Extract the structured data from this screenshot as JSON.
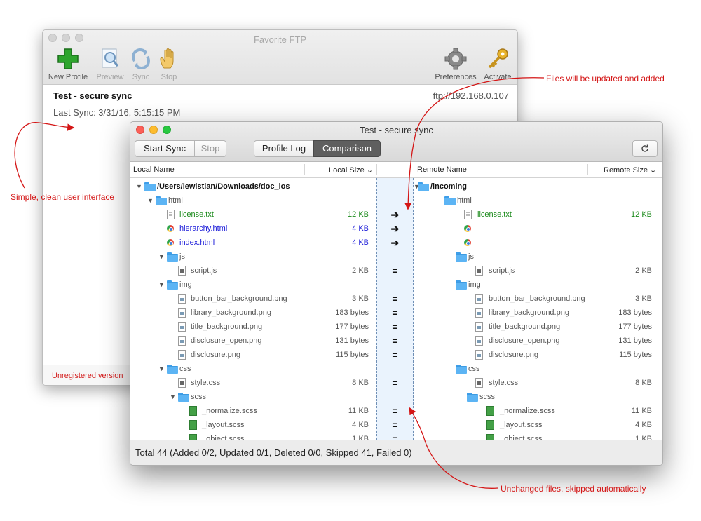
{
  "main_window": {
    "title": "Favorite FTP",
    "toolbar": [
      {
        "label": "New Profile",
        "icon": "plus-icon",
        "enabled": true
      },
      {
        "label": "Preview",
        "icon": "magnifier-icon",
        "enabled": false
      },
      {
        "label": "Sync",
        "icon": "sync-icon",
        "enabled": false
      },
      {
        "label": "Stop",
        "icon": "hand-icon",
        "enabled": false
      },
      {
        "label": "Preferences",
        "icon": "gear-icon",
        "enabled": true
      },
      {
        "label": "Activate",
        "icon": "key-icon",
        "enabled": true
      }
    ],
    "profile_name": "Test - secure sync",
    "profile_url": "ftp://192.168.0.107",
    "last_sync": "Last Sync: 3/31/16, 5:15:15 PM",
    "footer": "Unregistered version"
  },
  "sync_window": {
    "title": "Test - secure sync",
    "buttons": {
      "start": "Start Sync",
      "stop": "Stop",
      "profile_log": "Profile Log",
      "comparison": "Comparison"
    },
    "columns": {
      "local_name": "Local Name",
      "local_size": "Local Size",
      "remote_name": "Remote Name",
      "remote_size": "Remote Size"
    },
    "rows": [
      {
        "depth": 0,
        "type": "folder",
        "twisty": "▼",
        "local": "/Users/lewistian/Downloads/doc_ios",
        "local_size": "",
        "op": "",
        "remote": "/incoming",
        "remote_size": "",
        "bold": true
      },
      {
        "depth": 1,
        "type": "folder",
        "twisty": "▼",
        "local": "html",
        "local_size": "",
        "op": "",
        "remote": "html",
        "remote_size": ""
      },
      {
        "depth": 2,
        "type": "txt",
        "local": "license.txt",
        "local_size": "12 KB",
        "op": "➔",
        "remote": "license.txt",
        "remote_size": "12 KB",
        "color": "green"
      },
      {
        "depth": 2,
        "type": "html",
        "local": "hierarchy.html",
        "local_size": "4 KB",
        "op": "➔",
        "remote": "",
        "remote_size": "",
        "color": "blue"
      },
      {
        "depth": 2,
        "type": "html",
        "local": "index.html",
        "local_size": "4 KB",
        "op": "➔",
        "remote": "",
        "remote_size": "",
        "color": "blue"
      },
      {
        "depth": 2,
        "type": "folder",
        "twisty": "▼",
        "local": "js",
        "local_size": "",
        "op": "",
        "remote": "js",
        "remote_size": ""
      },
      {
        "depth": 3,
        "type": "js",
        "local": "script.js",
        "local_size": "2 KB",
        "op": "=",
        "remote": "script.js",
        "remote_size": "2 KB"
      },
      {
        "depth": 2,
        "type": "folder",
        "twisty": "▼",
        "local": "img",
        "local_size": "",
        "op": "",
        "remote": "img",
        "remote_size": ""
      },
      {
        "depth": 3,
        "type": "png",
        "local": "button_bar_background.png",
        "local_size": "3 KB",
        "op": "=",
        "remote": "button_bar_background.png",
        "remote_size": "3 KB"
      },
      {
        "depth": 3,
        "type": "png",
        "local": "library_background.png",
        "local_size": "183 bytes",
        "op": "=",
        "remote": "library_background.png",
        "remote_size": "183 bytes"
      },
      {
        "depth": 3,
        "type": "png",
        "local": "title_background.png",
        "local_size": "177 bytes",
        "op": "=",
        "remote": "title_background.png",
        "remote_size": "177 bytes"
      },
      {
        "depth": 3,
        "type": "png",
        "local": "disclosure_open.png",
        "local_size": "131 bytes",
        "op": "=",
        "remote": "disclosure_open.png",
        "remote_size": "131 bytes"
      },
      {
        "depth": 3,
        "type": "png",
        "local": "disclosure.png",
        "local_size": "115 bytes",
        "op": "=",
        "remote": "disclosure.png",
        "remote_size": "115 bytes"
      },
      {
        "depth": 2,
        "type": "folder",
        "twisty": "▼",
        "local": "css",
        "local_size": "",
        "op": "",
        "remote": "css",
        "remote_size": ""
      },
      {
        "depth": 3,
        "type": "css",
        "local": "style.css",
        "local_size": "8 KB",
        "op": "=",
        "remote": "style.css",
        "remote_size": "8 KB"
      },
      {
        "depth": 3,
        "type": "folder",
        "twisty": "▼",
        "local": "scss",
        "local_size": "",
        "op": "",
        "remote": "scss",
        "remote_size": ""
      },
      {
        "depth": 4,
        "type": "scss",
        "local": "_normalize.scss",
        "local_size": "11 KB",
        "op": "=",
        "remote": "_normalize.scss",
        "remote_size": "11 KB"
      },
      {
        "depth": 4,
        "type": "scss",
        "local": "_layout.scss",
        "local_size": "4 KB",
        "op": "=",
        "remote": "_layout.scss",
        "remote_size": "4 KB"
      },
      {
        "depth": 4,
        "type": "scss",
        "local": "_object.scss",
        "local_size": "1 KB",
        "op": "=",
        "remote": "_object.scss",
        "remote_size": "1 KB"
      }
    ],
    "status": "Total 44 (Added 0/2, Updated 0/1, Deleted 0/0, Skipped 41, Failed 0)"
  },
  "annotations": {
    "simple_ui": "Simple, clean user interface",
    "files_updated": "Files will be updated and added",
    "unchanged": "Unchanged files, skipped automatically"
  },
  "colors": {
    "annotation": "#d41515",
    "added": "#1a1ad8",
    "updated": "#1b8a1b"
  }
}
